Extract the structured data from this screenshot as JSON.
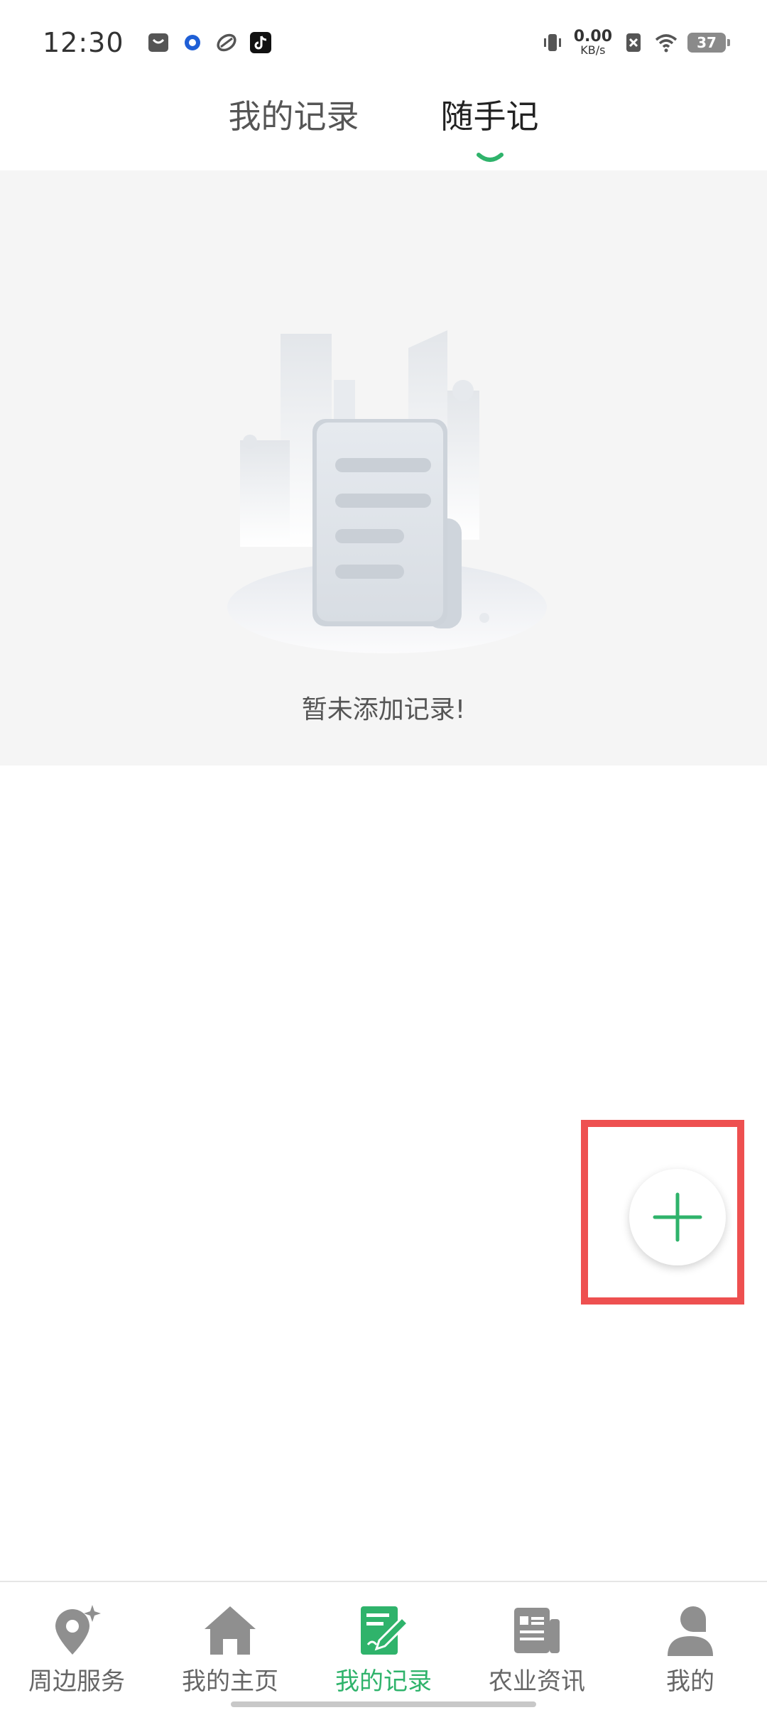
{
  "status_bar": {
    "time": "12:30",
    "net_speed_value": "0.00",
    "net_speed_unit": "KB/s",
    "battery": "37",
    "icons": [
      "message-icon",
      "browser-icon",
      "link-icon",
      "tiktok-icon",
      "vibrate-icon",
      "no-sim-icon",
      "wifi-icon",
      "battery-icon"
    ]
  },
  "tabs": [
    {
      "label": "我的记录",
      "active": false
    },
    {
      "label": "随手记",
      "active": true
    }
  ],
  "empty_state": {
    "message": "暂未添加记录!"
  },
  "fab": {
    "icon": "plus-icon"
  },
  "bottom_nav": [
    {
      "label": "周边服务",
      "icon": "location-icon",
      "active": false
    },
    {
      "label": "我的主页",
      "icon": "home-icon",
      "active": false
    },
    {
      "label": "我的记录",
      "icon": "notes-icon",
      "active": true
    },
    {
      "label": "农业资讯",
      "icon": "news-icon",
      "active": false
    },
    {
      "label": "我的",
      "icon": "user-icon",
      "active": false
    }
  ],
  "colors": {
    "accent": "#2fb36b",
    "panel_bg": "#f5f5f5",
    "highlight": "#ee5050"
  }
}
